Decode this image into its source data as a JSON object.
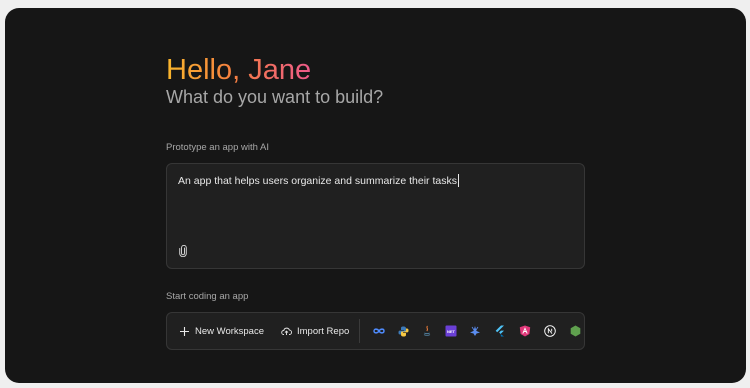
{
  "greeting": "Hello, Jane",
  "subtitle": "What do you want to build?",
  "prototype": {
    "label": "Prototype an app with AI",
    "prompt_value": "An app that helps users organize and summarize their tasks",
    "attach_icon": "paperclip-icon"
  },
  "start_coding": {
    "label": "Start coding an app",
    "new_workspace_label": "New Workspace",
    "import_repo_label": "Import Repo",
    "templates": [
      {
        "icon": "infinity-icon",
        "color": "#4f8cff"
      },
      {
        "icon": "python-icon",
        "color": "#f7c843"
      },
      {
        "icon": "java-icon",
        "color": "#e57a3a"
      },
      {
        "icon": "dotnet-icon",
        "color": "#6a3fd6"
      },
      {
        "icon": "ai-spark-icon",
        "color": "#5b8def"
      },
      {
        "icon": "flutter-icon",
        "color": "#4fc3f7"
      },
      {
        "icon": "angular-icon",
        "color": "#e0387a"
      },
      {
        "icon": "nextjs-icon",
        "color": "#ffffff"
      },
      {
        "icon": "nodejs-icon",
        "color": "#5fa04e"
      }
    ]
  },
  "colors": {
    "background": "#161616",
    "surface": "#202020",
    "border": "#363636",
    "greeting_gradient_start": "#f9b62c",
    "greeting_gradient_end": "#ee5a8a"
  }
}
